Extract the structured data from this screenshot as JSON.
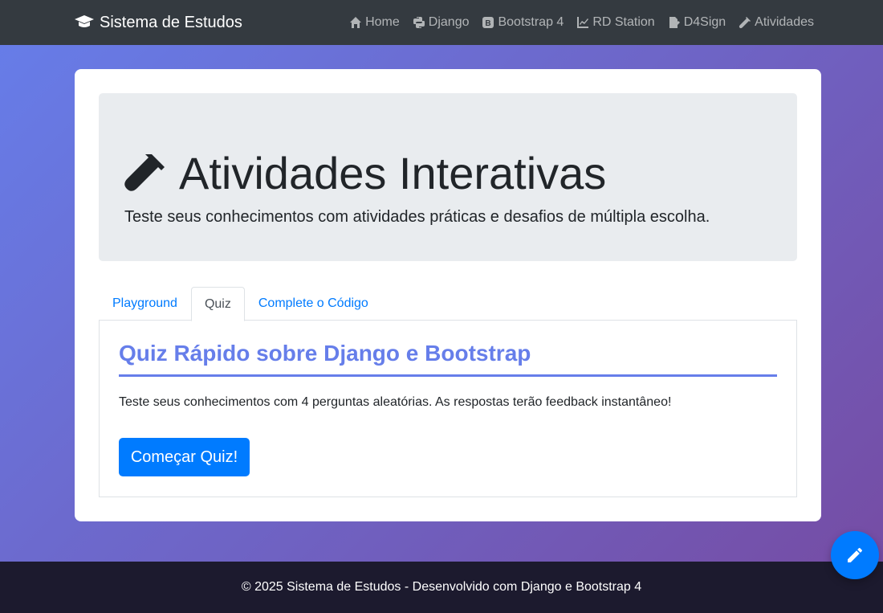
{
  "navbar": {
    "brand": "Sistema de Estudos",
    "items": [
      {
        "label": "Home",
        "icon": "home-icon"
      },
      {
        "label": "Django",
        "icon": "python-icon"
      },
      {
        "label": "Bootstrap 4",
        "icon": "bootstrap-icon"
      },
      {
        "label": "RD Station",
        "icon": "chart-line-icon"
      },
      {
        "label": "D4Sign",
        "icon": "file-signature-icon"
      },
      {
        "label": "Atividades",
        "icon": "vial-icon"
      }
    ]
  },
  "jumbotron": {
    "title": "Atividades Interativas",
    "lead": "Teste seus conhecimentos com atividades práticas e desafios de múltipla escolha."
  },
  "tabs": [
    {
      "label": "Playground",
      "active": false
    },
    {
      "label": "Quiz",
      "active": true
    },
    {
      "label": "Complete o Código",
      "active": false
    }
  ],
  "quiz": {
    "title": "Quiz Rápido sobre Django e Bootstrap",
    "description": "Teste seus conhecimentos com 4 perguntas aleatórias. As respostas terão feedback instantâneo!",
    "start_label": "Começar Quiz!"
  },
  "footer": {
    "text": "© 2025 Sistema de Estudos - Desenvolvido com Django e Bootstrap 4"
  },
  "colors": {
    "primary": "#007bff",
    "accent": "#667eea",
    "navbar": "#343a40"
  }
}
